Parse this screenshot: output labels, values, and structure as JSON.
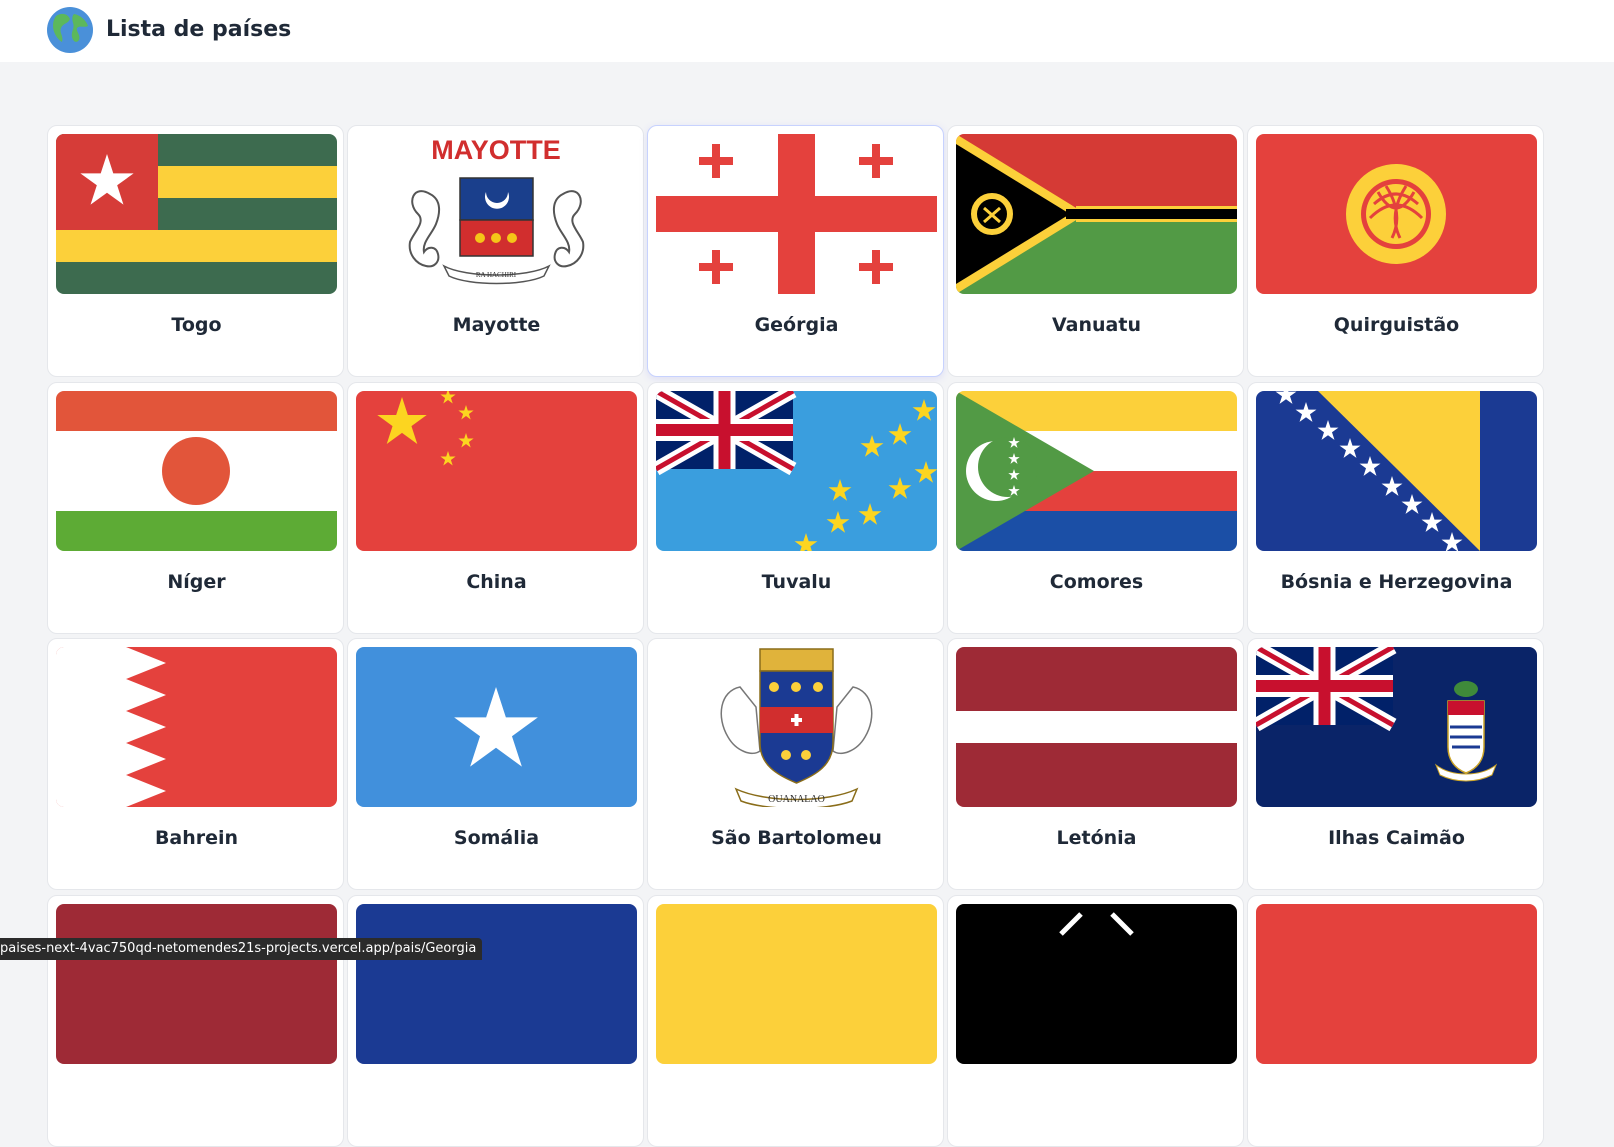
{
  "header": {
    "title": "Lista de países",
    "logo_icon": "globe-icon"
  },
  "countries": [
    {
      "name": "Togo",
      "flag_icon": "flag-togo-icon"
    },
    {
      "name": "Mayotte",
      "flag_icon": "flag-mayotte-icon",
      "flag_text": "MAYOTTE",
      "motto": "RA HACHIRI"
    },
    {
      "name": "Geórgia",
      "flag_icon": "flag-georgia-icon"
    },
    {
      "name": "Vanuatu",
      "flag_icon": "flag-vanuatu-icon"
    },
    {
      "name": "Quirguistão",
      "flag_icon": "flag-kyrgyzstan-icon"
    },
    {
      "name": "Níger",
      "flag_icon": "flag-niger-icon"
    },
    {
      "name": "China",
      "flag_icon": "flag-china-icon"
    },
    {
      "name": "Tuvalu",
      "flag_icon": "flag-tuvalu-icon"
    },
    {
      "name": "Comores",
      "flag_icon": "flag-comoros-icon"
    },
    {
      "name": "Bósnia e Herzegovina",
      "flag_icon": "flag-bosnia-icon"
    },
    {
      "name": "Bahrein",
      "flag_icon": "flag-bahrain-icon"
    },
    {
      "name": "Somália",
      "flag_icon": "flag-somalia-icon"
    },
    {
      "name": "São Bartolomeu",
      "flag_icon": "flag-saint-barthelemy-icon",
      "motto": "OUANALAO"
    },
    {
      "name": "Letónia",
      "flag_icon": "flag-latvia-icon"
    },
    {
      "name": "Ilhas Caimão",
      "flag_icon": "flag-cayman-islands-icon"
    }
  ],
  "status_bar": {
    "url": "paises-next-4vac750qd-netomendes21s-projects.vercel.app/pais/Georgia"
  },
  "colors": {
    "page_background": "#f3f4f6",
    "card_border": "#e5e7eb",
    "card_hover_border": "#c7d2fe",
    "text": "#1f2937"
  }
}
